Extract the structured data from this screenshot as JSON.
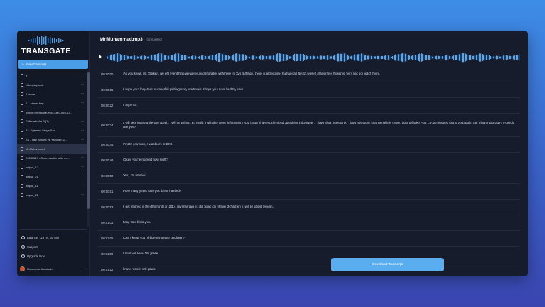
{
  "brand": {
    "name": "TRANSGATE"
  },
  "sidebar": {
    "new_label": "New Transcript",
    "files": [
      {
        "label": "3"
      },
      {
        "label": "videoplayback"
      },
      {
        "label": "6-murat"
      },
      {
        "label": "1---Ahmet bey"
      },
      {
        "label": "userId=9fc9bd8e-e6cf-44e7-bc9-13..."
      },
      {
        "label": "Falkenstraße 3 (1)"
      },
      {
        "label": "42. Egemen Yahya Sarı"
      },
      {
        "label": "K8 - Yapı Anlamı ve Yapılığın Z..."
      },
      {
        "label": "Mr.Muhammad",
        "active": true
      },
      {
        "label": "20240517 - Conversation with me..."
      },
      {
        "label": "output_12"
      },
      {
        "label": "output_21"
      },
      {
        "label": "output_11"
      },
      {
        "label": "output_22"
      }
    ],
    "balance": "Balance: 119 hr , 30 min",
    "support": "Support",
    "upgrade": "Upgrade Now",
    "user_name": "Muhammad Abualsalm"
  },
  "main": {
    "file_title": "Mr.Muhammad.mp3",
    "status": "- completed",
    "download_label": "Download Transcript",
    "segments": [
      {
        "ts": "00:00:00",
        "text": "As you know, Mr. Gürkan, we left everything we were uncomfortable with here, in Oya Bahadır, there is a brochure that we call Niyaz, we left all our free thoughts here and got rid of them."
      },
      {
        "ts": "00:00:15",
        "text": "I hope your long-term successful quitting story continues, I hope you have healthy days."
      },
      {
        "ts": "00:00:22",
        "text": "I hope so."
      },
      {
        "ts": "00:00:24",
        "text": "I will take notes while you speak, I will be writing, as I said, I will take some information, you know, I have such mixed questions in between, I have clear questions, I have questions that are a little longer, but I will take your 15-20 minutes, thank you again, can I learn your age? How old are you?"
      },
      {
        "ts": "00:00:45",
        "text": "I'm 32 years old, I was born in 1990."
      },
      {
        "ts": "00:00:48",
        "text": "Okay, you're married now, right?"
      },
      {
        "ts": "00:00:50",
        "text": "Yes, I'm married."
      },
      {
        "ts": "00:00:51",
        "text": "How many years have you been married?"
      },
      {
        "ts": "00:00:53",
        "text": "I got married in the 4th month of 2014, my marriage is still going on, I have 3 children, it will be about 9 years."
      },
      {
        "ts": "00:01:03",
        "text": "May God bless you."
      },
      {
        "ts": "00:01:05",
        "text": "Can I know your children's gender and age?"
      },
      {
        "ts": "00:01:09",
        "text": "Umut will be in 7th grade."
      },
      {
        "ts": "00:01:12",
        "text": "İnanır was in 3rd grade."
      }
    ]
  },
  "colors": {
    "accent": "#4a9ee8",
    "waveform": "#5aa6ee",
    "panel": "#161c2c"
  }
}
